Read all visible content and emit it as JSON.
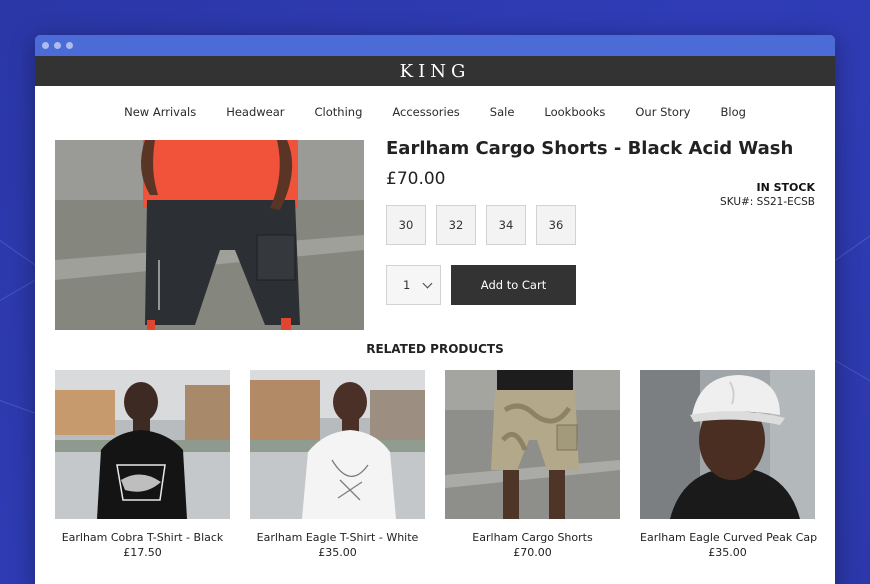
{
  "brand": "KING",
  "nav": [
    "New Arrivals",
    "Headwear",
    "Clothing",
    "Accessories",
    "Sale",
    "Lookbooks",
    "Our Story",
    "Blog"
  ],
  "product": {
    "title": "Earlham Cargo Shorts - Black Acid Wash",
    "price": "£70.00",
    "stock": "IN STOCK",
    "sku": "SKU#: SS21-ECSB",
    "sizes": [
      "30",
      "32",
      "34",
      "36"
    ],
    "quantity": "1",
    "add_to_cart": "Add to Cart"
  },
  "related": {
    "title": "RELATED PRODUCTS",
    "items": [
      {
        "name": "Earlham Cobra T-Shirt - Black",
        "price": "£17.50"
      },
      {
        "name": "Earlham Eagle T-Shirt - White",
        "price": "£35.00"
      },
      {
        "name": "Earlham Cargo Shorts",
        "price": "£70.00"
      },
      {
        "name": "Earlham Eagle Curved Peak Cap",
        "price": "£35.00"
      }
    ]
  }
}
